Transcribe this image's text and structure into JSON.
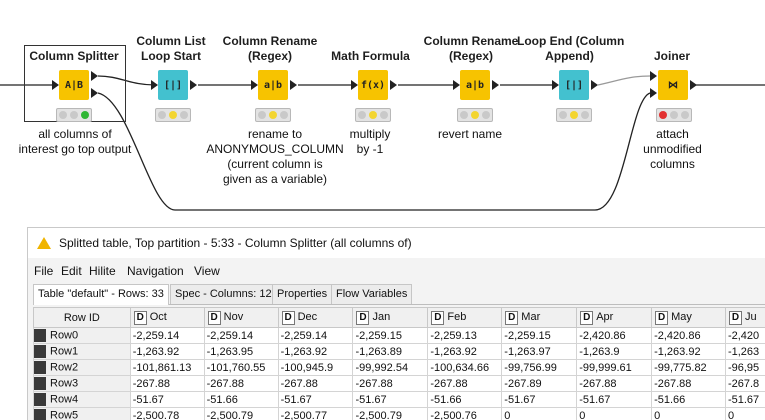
{
  "workflow": {
    "nodes": [
      {
        "title": "Column Splitter",
        "desc": "all columns of\ninterest go top output",
        "icon": "column-splitter-icon",
        "status": "green",
        "icon_glyph": "A|B"
      },
      {
        "title": "Column List\nLoop Start",
        "desc": "",
        "icon": "loop-start-icon",
        "status": "yellow",
        "icon_glyph": "[|]"
      },
      {
        "title": "Column Rename\n(Regex)",
        "desc": "rename to\nANONYMOUS_COLUMN\n(current column is\ngiven as a variable)",
        "icon": "rename-regex-icon",
        "status": "yellow",
        "icon_glyph": "a|b"
      },
      {
        "title": "Math Formula",
        "desc": "multiply\nby -1",
        "icon": "math-formula-icon",
        "status": "yellow",
        "icon_glyph": "f(x)"
      },
      {
        "title": "Column Rename\n(Regex)",
        "desc": "revert name",
        "icon": "rename-regex-icon",
        "status": "yellow",
        "icon_glyph": "a|b"
      },
      {
        "title": "Loop End (Column\nAppend)",
        "desc": "",
        "icon": "loop-end-icon",
        "status": "yellow",
        "icon_glyph": "[|]"
      },
      {
        "title": "Joiner",
        "desc": "attach\nunmodified\ncolumns",
        "icon": "joiner-icon",
        "status": "red",
        "icon_glyph": "⋈"
      }
    ]
  },
  "table_window": {
    "title": "Splitted table, Top partition - 5:33 - Column Splitter (all columns of)",
    "menu": [
      "File",
      "Edit",
      "Hilite",
      "Navigation",
      "View"
    ],
    "tabs": [
      "Table \"default\" - Rows: 33",
      "Spec - Columns: 12",
      "Properties",
      "Flow Variables"
    ],
    "columns": [
      "Row ID",
      "Oct",
      "Nov",
      "Dec",
      "Jan",
      "Feb",
      "Mar",
      "Apr",
      "May",
      "Ju"
    ],
    "column_type_letter": "D",
    "rows": [
      [
        "Row0",
        "-2,259.14",
        "-2,259.14",
        "-2,259.14",
        "-2,259.15",
        "-2,259.13",
        "-2,259.15",
        "-2,420.86",
        "-2,420.86",
        "-2,420"
      ],
      [
        "Row1",
        "-1,263.92",
        "-1,263.95",
        "-1,263.92",
        "-1,263.89",
        "-1,263.92",
        "-1,263.97",
        "-1,263.9",
        "-1,263.92",
        "-1,263"
      ],
      [
        "Row2",
        "-101,861.13",
        "-101,760.55",
        "-100,945.9",
        "-99,992.54",
        "-100,634.66",
        "-99,756.99",
        "-99,999.61",
        "-99,775.82",
        "-96,95"
      ],
      [
        "Row3",
        "-267.88",
        "-267.88",
        "-267.88",
        "-267.88",
        "-267.88",
        "-267.89",
        "-267.88",
        "-267.88",
        "-267.8"
      ],
      [
        "Row4",
        "-51.67",
        "-51.66",
        "-51.67",
        "-51.67",
        "-51.66",
        "-51.67",
        "-51.67",
        "-51.66",
        "-51.67"
      ],
      [
        "Row5",
        "-2,500.78",
        "-2,500.79",
        "-2,500.77",
        "-2,500.79",
        "-2,500.76",
        "0",
        "0",
        "0",
        "0"
      ]
    ]
  }
}
